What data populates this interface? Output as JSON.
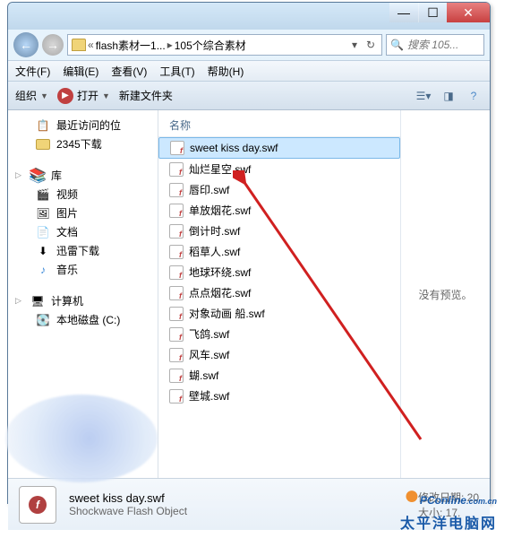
{
  "window_controls": {
    "min": "—",
    "max": "☐",
    "close": "✕"
  },
  "nav": {
    "back": "←",
    "fwd": "→",
    "bc_sep": "«",
    "bc_arrow": "▸",
    "path1": "flash素材一1...",
    "path2": "105个综合素材",
    "refresh": "↻",
    "dropdown": "▾"
  },
  "search": {
    "placeholder": "搜索 105..."
  },
  "menu": {
    "file": "文件(F)",
    "edit": "编辑(E)",
    "view": "查看(V)",
    "tools": "工具(T)",
    "help": "帮助(H)"
  },
  "toolbar": {
    "organize": "组织",
    "open": "打开",
    "newfolder": "新建文件夹"
  },
  "sidebar": {
    "recent": "最近访问的位",
    "downloads": "2345下载",
    "libraries": "库",
    "videos": "视频",
    "pictures": "图片",
    "documents": "文档",
    "xunlei": "迅雷下载",
    "music": "音乐",
    "computer": "计算机",
    "localdisk": "本地磁盘 (C:)"
  },
  "col_name": "名称",
  "files": [
    "sweet kiss day.swf",
    "灿烂星空.swf",
    "唇印.swf",
    "单放烟花.swf",
    "倒计时.swf",
    "稻草人.swf",
    "地球环绕.swf",
    "点点烟花.swf",
    "对象动画 船.swf",
    "飞鸽.swf",
    "风车.swf",
    "蝴.swf",
    "壁城.swf"
  ],
  "preview_text": "没有预览。",
  "details": {
    "name": "sweet kiss day.swf",
    "type": "Shockwave Flash Object",
    "date_label": "修改日期:",
    "date_val": "20",
    "size_label": "大小:",
    "size_val": "17."
  },
  "watermark": {
    "brand": "PC",
    "brand2": "online",
    "domain": ".com.cn",
    "sub": "太平洋电脑网"
  }
}
